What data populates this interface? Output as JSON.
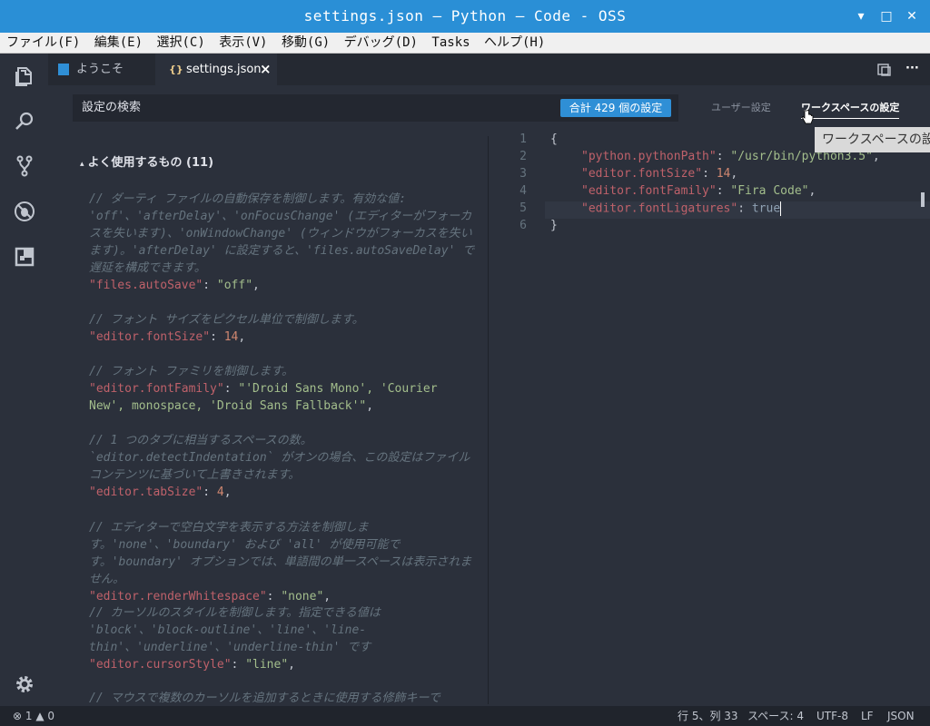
{
  "window": {
    "title": "settings.json — Python — Code - OSS",
    "minimize": "▾",
    "maximize": "□",
    "close": "✕"
  },
  "menu": [
    "ファイル(F)",
    "編集(E)",
    "選択(C)",
    "表示(V)",
    "移動(G)",
    "デバッグ(D)",
    "Tasks",
    "ヘルプ(H)"
  ],
  "tabs": {
    "welcome": "ようこそ",
    "settings_icon": "{}",
    "settings": "settings.json",
    "close": "×"
  },
  "tab_actions": {
    "split": "split-editor-icon",
    "more": "···"
  },
  "activity": [
    "explorer-icon",
    "search-icon",
    "source-control-icon",
    "debug-icon",
    "extensions-icon",
    "gear-icon"
  ],
  "search": {
    "placeholder": "設定の検索",
    "count_badge": "合計 429 個の設定"
  },
  "scopes": {
    "user": "ユーザー設定",
    "workspace": "ワークスペースの設定"
  },
  "tooltip": "ワークスペースの設定",
  "defaults": {
    "group_title": "よく使用するもの (11)",
    "items": [
      {
        "comment": "// ダーティ ファイルの自動保存を制御します。有効な値: 'off'、'afterDelay'、'onFocusChange' (エディターがフォーカスを失います)、'onWindowChange' (ウィンドウがフォーカスを失います)。'afterDelay' に設定すると、'files.autoSaveDelay' で遅延を構成できます。",
        "key": "\"files.autoSave\"",
        "sep": ": ",
        "value": "\"off\"",
        "tail": ",",
        "value_type": "string"
      },
      {
        "comment": "// フォント サイズをピクセル単位で制御します。",
        "key": "\"editor.fontSize\"",
        "sep": ": ",
        "value": "14",
        "tail": ",",
        "value_type": "number"
      },
      {
        "comment": "// フォント ファミリを制御します。",
        "key": "\"editor.fontFamily\"",
        "sep": ": ",
        "value": "\"'Droid Sans Mono', 'Courier New', monospace, 'Droid Sans Fallback'\"",
        "tail": ",",
        "value_type": "string"
      },
      {
        "comment": "// 1 つのタブに相当するスペースの数。`editor.detectIndentation` がオンの場合、この設定はファイル コンテンツに基づいて上書きされます。",
        "key": "\"editor.tabSize\"",
        "sep": ": ",
        "value": "4",
        "tail": ",",
        "value_type": "number"
      },
      {
        "comment": "// エディターで空白文字を表示する方法を制御します。'none'、'boundary' および 'all' が使用可能です。'boundary' オプションでは、単語間の単一スペースは表示されません。",
        "key": "\"editor.renderWhitespace\"",
        "sep": ": ",
        "value": "\"none\"",
        "tail": ",",
        "value_type": "string"
      },
      {
        "comment": "// カーソルのスタイルを制御します。指定できる値は 'block'、'block-outline'、'line'、'line-thin'、'underline'、'underline-thin' です",
        "key": "\"editor.cursorStyle\"",
        "sep": ": ",
        "value": "\"line\"",
        "tail": ",",
        "value_type": "string"
      },
      {
        "comment": "// マウスで複数のカーソルを追加するときに使用する修飾キーで",
        "key": "",
        "sep": "",
        "value": "",
        "tail": "",
        "value_type": "none"
      }
    ]
  },
  "user_file": {
    "lines": [
      {
        "num": "1",
        "text": "{"
      },
      {
        "num": "2",
        "key": "\"python.pythonPath\"",
        "sep": ": ",
        "value": "\"/usr/bin/python3.5\"",
        "tail": ",",
        "value_type": "string"
      },
      {
        "num": "3",
        "key": "\"editor.fontSize\"",
        "sep": ": ",
        "value": "14",
        "tail": ",",
        "value_type": "number"
      },
      {
        "num": "4",
        "key": "\"editor.fontFamily\"",
        "sep": ": ",
        "value": "\"Fira Code\"",
        "tail": ",",
        "value_type": "string"
      },
      {
        "num": "5",
        "key": "\"editor.fontLigatures\"",
        "sep": ": ",
        "value": "true",
        "tail": "",
        "value_type": "bool"
      },
      {
        "num": "6",
        "text": "}"
      }
    ]
  },
  "status": {
    "errors": "1",
    "warnings": "0",
    "position": "行 5、列 33",
    "indent": "スペース: 4",
    "encoding": "UTF-8",
    "eol": "LF",
    "language": "JSON"
  }
}
